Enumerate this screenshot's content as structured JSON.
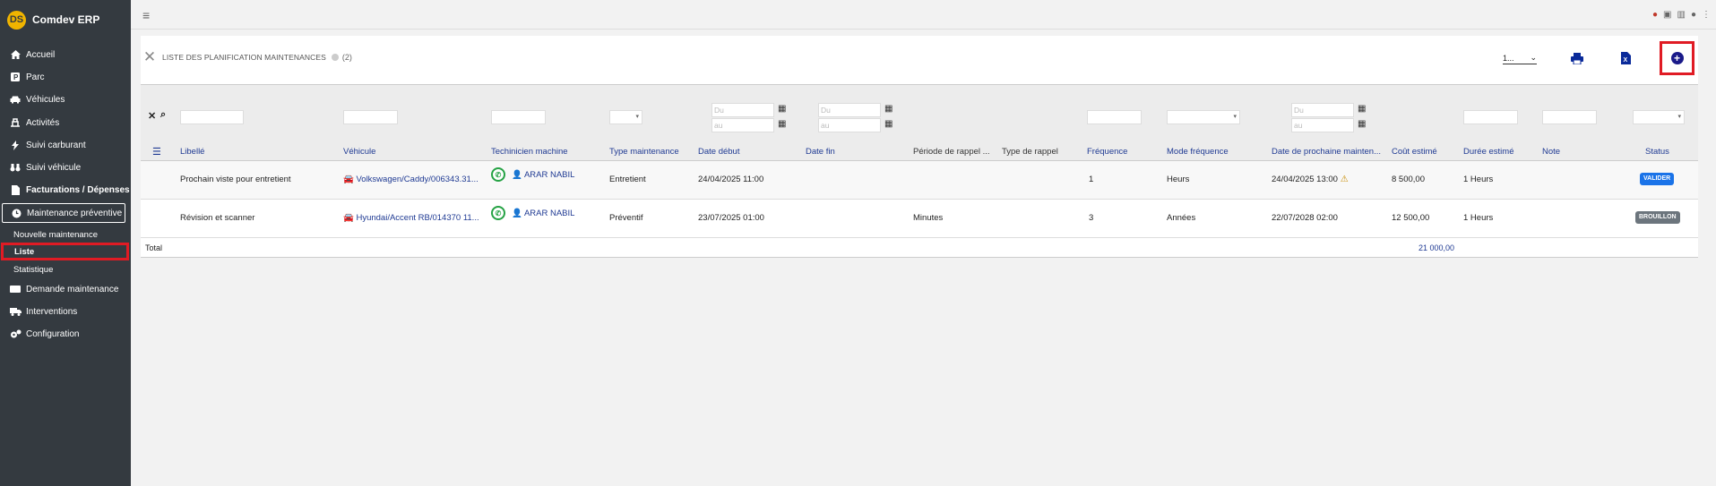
{
  "sidebar": {
    "brand": "Comdev ERP",
    "logo_text": "DS",
    "items": [
      {
        "label": "Accueil",
        "icon": "home-icon"
      },
      {
        "label": "Parc",
        "icon": "parking-icon"
      },
      {
        "label": "Véhicules",
        "icon": "car-icon"
      },
      {
        "label": "Activités",
        "icon": "activity-icon"
      },
      {
        "label": "Suivi carburant",
        "icon": "fuel-icon"
      },
      {
        "label": "Suivi véhicule",
        "icon": "binoculars-icon"
      },
      {
        "label": "Facturations / Dépenses",
        "icon": "invoice-icon"
      },
      {
        "label": "Maintenance préventive",
        "icon": "clock-icon"
      },
      {
        "label": "Demande maintenance",
        "icon": "ticket-icon"
      },
      {
        "label": "Interventions",
        "icon": "truck-icon"
      },
      {
        "label": "Configuration",
        "icon": "cogs-icon"
      }
    ],
    "subitems": [
      {
        "label": "Nouvelle maintenance"
      },
      {
        "label": "Liste"
      },
      {
        "label": "Statistique"
      }
    ]
  },
  "page": {
    "title": "LISTE DES PLANIFICATION MAINTENANCES",
    "count": "(2)",
    "page_size": "1..."
  },
  "filters": {
    "du": "Du",
    "au": "au"
  },
  "table": {
    "headers": [
      "Libellé",
      "Véhicule",
      "Techinicien machine",
      "Type maintenance",
      "Date début",
      "Date fin",
      "Période de rappel ...",
      "Type de rappel",
      "Fréquence",
      "Mode fréquence",
      "Date de prochaine mainten...",
      "Coût estimé",
      "Durée estimé",
      "Note",
      "Status"
    ],
    "rows": [
      {
        "libelle": "Prochain viste pour entretient",
        "vehicule": "Volkswagen/Caddy/006343.31...",
        "technicien": "ARAR NABIL",
        "type": "Entretient",
        "debut": "24/04/2025 11:00",
        "fin": "",
        "periode": "",
        "type_rappel": "",
        "frequence": "1",
        "mode": "Heurs",
        "prochaine": "24/04/2025 13:00",
        "cout": "8 500,00",
        "duree": "1 Heurs",
        "note": "",
        "status": "VALIDER",
        "status_color": "#1a73e8"
      },
      {
        "libelle": "Révision et scanner",
        "vehicule": "Hyundai/Accent RB/014370 11...",
        "technicien": "ARAR NABIL",
        "type": "Préventif",
        "debut": "23/07/2025 01:00",
        "fin": "",
        "periode": "Minutes",
        "type_rappel": "",
        "frequence": "3",
        "mode": "Années",
        "prochaine": "22/07/2028 02:00",
        "cout": "12 500,00",
        "duree": "1 Heurs",
        "note": "",
        "status": "BROUILLON",
        "status_color": "#6c757d"
      }
    ],
    "total_label": "Total",
    "total_value": "21 000,00"
  }
}
